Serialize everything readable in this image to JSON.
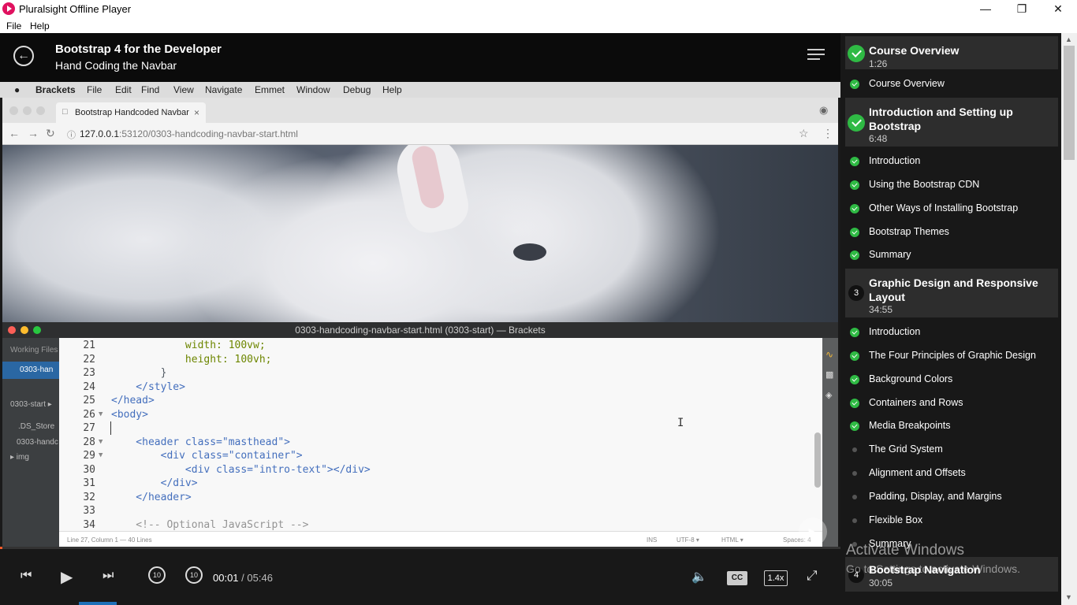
{
  "window": {
    "title": "Pluralsight Offline Player",
    "minimize_icon": "minimize-icon",
    "maximize_icon": "restore-icon",
    "close_icon": "close-icon"
  },
  "app_menu": {
    "items": [
      "File",
      "Help"
    ]
  },
  "header": {
    "course_title": "Bootstrap 4 for the Developer",
    "module_title": "Hand Coding the Navbar"
  },
  "video": {
    "mac_menu": [
      "Brackets",
      "File",
      "Edit",
      "Find",
      "View",
      "Navigate",
      "Emmet",
      "Window",
      "Debug",
      "Help"
    ],
    "browser_tab": "Bootstrap Handcoded Navbar",
    "browser_tab_close": "×",
    "url_host": "127.0.0.1",
    "url_rest": ":53120/0303-handcoding-navbar-start.html",
    "editor_title": "0303-handcoding-navbar-start.html (0303-start) — Brackets",
    "sidebar": {
      "working_files": "Working Files",
      "active_file": "0303-han",
      "project": "0303-start ▸",
      "files": [
        ".DS_Store",
        "0303-handc",
        "▸ img"
      ]
    },
    "code_lines": [
      {
        "n": "21",
        "text": "            width: 100vw;"
      },
      {
        "n": "22",
        "text": "            height: 100vh;"
      },
      {
        "n": "23",
        "text": "        }"
      },
      {
        "n": "24",
        "text": "    </style>"
      },
      {
        "n": "25",
        "text": "</head>"
      },
      {
        "n": "26",
        "text": "<body>"
      },
      {
        "n": "27",
        "text": ""
      },
      {
        "n": "28",
        "text": "    <header class=\"masthead\">"
      },
      {
        "n": "29",
        "text": "        <div class=\"container\">"
      },
      {
        "n": "30",
        "text": "            <div class=\"intro-text\"></div>"
      },
      {
        "n": "31",
        "text": "        </div>"
      },
      {
        "n": "32",
        "text": "    </header>"
      },
      {
        "n": "33",
        "text": ""
      },
      {
        "n": "34",
        "text": "    <!-- Optional JavaScript -->"
      }
    ],
    "status": {
      "position": "Line 27, Column 1 — 40 Lines",
      "mode_ins": "INS",
      "encoding": "UTF-8 ▾",
      "language": "HTML ▾",
      "spaces": "Spaces: 4"
    }
  },
  "player": {
    "current_time": "00:01",
    "separator": "/",
    "duration": "05:46",
    "progress_fraction": 0.003,
    "cc_label": "CC",
    "speed_label": "1.4x",
    "icons": [
      "skip-previous-icon",
      "play-icon",
      "skip-next-icon",
      "rewind-10-icon",
      "forward-10-icon",
      "volume-icon",
      "closed-captions-icon",
      "fullscreen-icon"
    ]
  },
  "toc": {
    "modules": [
      {
        "title": "Course Overview",
        "duration": "1:26",
        "status": "complete",
        "number": ""
      },
      {
        "title": "Introduction and Setting up Bootstrap",
        "duration": "6:48",
        "status": "complete",
        "number": ""
      },
      {
        "title": "Graphic Design and Responsive Layout",
        "duration": "34:55",
        "status": "incomplete",
        "number": "3"
      },
      {
        "title": "Bootstrap Navigation",
        "duration": "30:05",
        "status": "incomplete",
        "number": "4"
      }
    ],
    "clips_module1": [
      {
        "title": "Course Overview",
        "done": true
      }
    ],
    "clips_module2": [
      {
        "title": "Introduction",
        "done": true
      },
      {
        "title": "Using the Bootstrap CDN",
        "done": true
      },
      {
        "title": "Other Ways of Installing Bootstrap",
        "done": true
      },
      {
        "title": "Bootstrap Themes",
        "done": true
      },
      {
        "title": "Summary",
        "done": true
      }
    ],
    "clips_module3": [
      {
        "title": "Introduction",
        "done": true
      },
      {
        "title": "The Four Principles of Graphic Design",
        "done": true
      },
      {
        "title": "Background Colors",
        "done": true
      },
      {
        "title": "Containers and Rows",
        "done": true
      },
      {
        "title": "Media Breakpoints",
        "done": true
      },
      {
        "title": "The Grid System",
        "done": false
      },
      {
        "title": "Alignment and Offsets",
        "done": false
      },
      {
        "title": "Padding, Display, and Margins",
        "done": false
      },
      {
        "title": "Flexible Box",
        "done": false
      },
      {
        "title": "Summary",
        "done": false
      }
    ]
  },
  "watermark": {
    "line1": "Activate Windows",
    "line2": "Go to Settings to activate Windows."
  },
  "colors": {
    "complete_green": "#2fba44",
    "progress_orange": "#f15b2a",
    "sidebar_bg": "#181818",
    "module_bg": "#2d2d2d"
  }
}
